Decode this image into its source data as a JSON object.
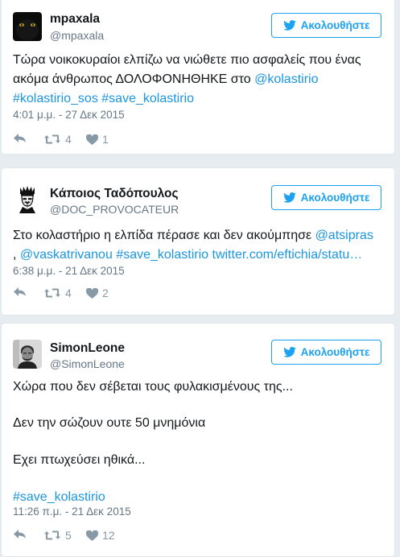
{
  "follow_label": "Ακολουθήστε",
  "tweets": [
    {
      "name": "mpaxala",
      "handle": "@mpaxala",
      "lines": [
        [
          {
            "t": "Τώρα νοικοκυραίοι ελπίζω να νιώθετε πιο ασφαλείς που ένας",
            "link": false
          }
        ],
        [
          {
            "t": "ακόμα άνθρωπος ΔΟΛΟΦΟΝΗΘΗΚΕ στο ",
            "link": false
          },
          {
            "t": "@kolastirio",
            "link": true
          }
        ],
        [
          {
            "t": "#kolastirio_sos",
            "link": true
          },
          {
            "t": " ",
            "link": false
          },
          {
            "t": "#save_kolastirio",
            "link": true
          }
        ]
      ],
      "timestamp": "4:01 μ.μ. - 27 Δεκ 2015",
      "retweets": "4",
      "likes": "1"
    },
    {
      "name": "Κάποιος Ταδόπουλος",
      "handle": "@DOC_PROVOCATEUR",
      "lines": [
        [
          {
            "t": "Στο κολαστήριο η ελπίδα πέρασε και δεν ακούμπησε ",
            "link": false
          },
          {
            "t": "@atsipras",
            "link": true
          }
        ],
        [
          {
            "t": ", ",
            "link": false
          },
          {
            "t": "@vaskatrivanou",
            "link": true
          },
          {
            "t": " ",
            "link": false
          },
          {
            "t": "#save_kolastirio",
            "link": true
          },
          {
            "t": " ",
            "link": false
          },
          {
            "t": "twitter.com/eftichia/statu…",
            "link": true
          }
        ]
      ],
      "timestamp": "6:38 μ.μ. - 21 Δεκ 2015",
      "retweets": "4",
      "likes": "2"
    },
    {
      "name": "SimonLeone",
      "handle": "@SimonLeone",
      "lines": [
        [
          {
            "t": "Χώρα που δεν σέβεται τους φυλακισμένους της...",
            "link": false
          }
        ],
        [
          {
            "t": "Δεν την σώζουν ουτε 50 μνημόνια",
            "link": false
          }
        ],
        [
          {
            "t": "Εχει πτωχεύσει ηθικά...",
            "link": false
          }
        ],
        [
          {
            "t": "#save_kolastirio",
            "link": true
          }
        ]
      ],
      "timestamp": "11:26 π.μ. - 21 Δεκ 2015",
      "retweets": "5",
      "likes": "12"
    }
  ]
}
